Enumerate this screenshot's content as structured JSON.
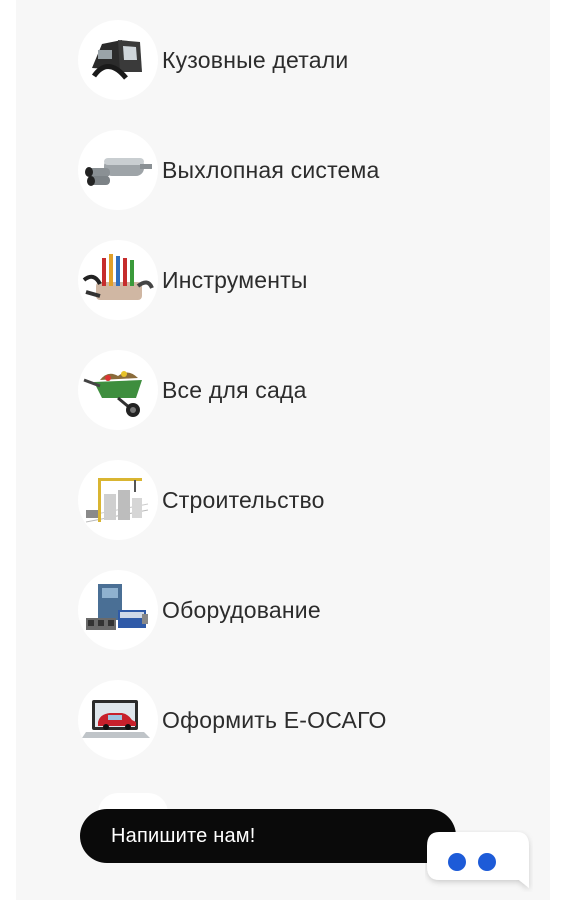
{
  "categories": [
    {
      "label": "Кузовные детали",
      "icon": "car-body-parts-icon"
    },
    {
      "label": "Выхлопная система",
      "icon": "exhaust-muffler-icon"
    },
    {
      "label": "Инструменты",
      "icon": "tools-set-icon"
    },
    {
      "label": "Все для сада",
      "icon": "wheelbarrow-icon"
    },
    {
      "label": "Строительство",
      "icon": "construction-crane-icon"
    },
    {
      "label": "Оборудование",
      "icon": "equipment-machine-icon"
    },
    {
      "label": "Оформить Е-ОСАГО",
      "icon": "laptop-car-icon"
    }
  ],
  "chat": {
    "label": "Напишите нам!",
    "icon": "chat-bubble-icon",
    "accent_color": "#1d5bd8",
    "bar_color": "#0a0a0a"
  }
}
